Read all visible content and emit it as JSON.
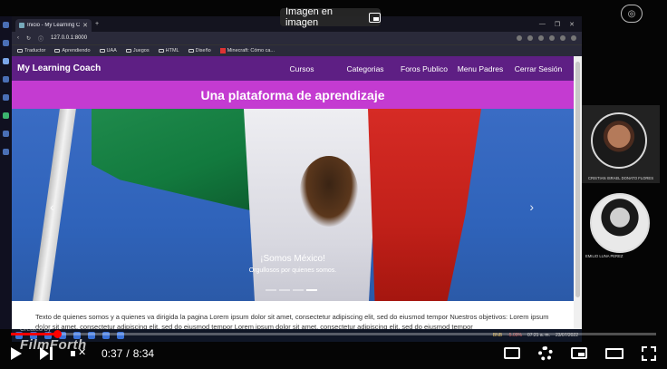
{
  "player": {
    "pip_label": "Imagen en imagen",
    "current_time": "0:37",
    "duration": "8:34",
    "time_separator": "/",
    "progress_fraction": 0.072,
    "watermark": "FilmForth",
    "watermark_small": "Created by"
  },
  "browser": {
    "tab_title": "Inicio - My Learning Coach",
    "url": "127.0.0.1:8000",
    "bookmarks": [
      "Traductor",
      "Aprendiendo",
      "UAA",
      "Juegos",
      "HTML",
      "Diseño",
      "Minecraft: Cómo ca..."
    ]
  },
  "site": {
    "brand": "My Learning Coach",
    "nav": [
      "Cursos",
      "Categorias",
      "Foros Publico",
      "Menu Padres",
      "Cerrar Sesión"
    ],
    "tagline": "Una plataforma de aprendizaje",
    "carousel": {
      "caption_title": "¡Somos México!",
      "caption_sub": "Orgullosos por quienes somos.",
      "slide_count": 4,
      "active_slide": 3
    },
    "body_text": "Texto de quienes somos y a quienes va dirigida la pagina Lorem ipsum dolor sit amet, consectetur adipiscing elit, sed do eiusmod tempor Nuestros objetivos: Lorem ipsum dolor sit amet, consectetur adipiscing elit, sed do eiusmod tempor Lorem ipsum dolor sit amet, consectetur adipiscing elit, sed do eiusmod tempor"
  },
  "webcams": {
    "person1": "CRISTIAN ISRAEL DONATO FLORES",
    "person2": "EMILIO LUNA PEREZ"
  },
  "taskbar": {
    "ticker": "BNB",
    "change": "-5.09%",
    "time": "07:21 a. m.",
    "date": "23/07/2022"
  },
  "colors": {
    "navbar": "#5e1f84",
    "tagline_band": "#c43bd1",
    "progress": "#ff0000"
  }
}
